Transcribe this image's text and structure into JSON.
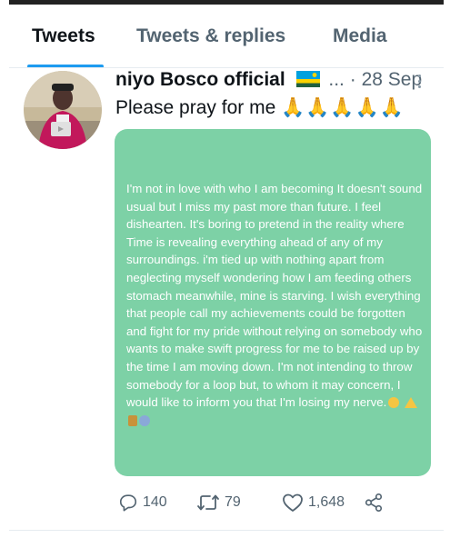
{
  "tabs": [
    {
      "label": "Tweets",
      "active": true
    },
    {
      "label": "Tweets & replies",
      "active": false
    },
    {
      "label": "Media",
      "active": false
    }
  ],
  "tweet": {
    "author_name": "niyo Bosco official",
    "flag_icon": "rwanda-flag-icon",
    "name_truncation": "...",
    "separator": "·",
    "date": "28 Sep",
    "text": "Please pray for me",
    "text_emoji_icon": "folded-hands-icon",
    "text_emoji": "🙏🙏🙏🙏🙏",
    "image_text": "I'm not in love with who I am becoming It doesn't sound usual but I miss my past more than future. I feel dishearten. It's boring to pretend in the reality where Time is revealing everything ahead of any of my surroundings. i'm tied up with nothing apart from neglecting myself wondering how I am feeding others stomach meanwhile, mine is starving. I wish everything that people call my achievements could be forgotten and fight for my pride without relying on somebody who wants to make swift progress for me to be raised up by the time I am moving down. I'm not intending to throw somebody for a loop but, to whom it may concern, I would like to inform you that I'm losing my nerve.",
    "image_background": "#7dd1a6",
    "replies": "140",
    "retweets": "79",
    "likes": "1,648"
  },
  "colors": {
    "accent": "#1d9bf0",
    "text_primary": "#0f1419",
    "text_secondary": "#536471"
  },
  "icons": [
    "reply-icon",
    "retweet-icon",
    "like-icon",
    "share-icon",
    "more-options-icon"
  ]
}
